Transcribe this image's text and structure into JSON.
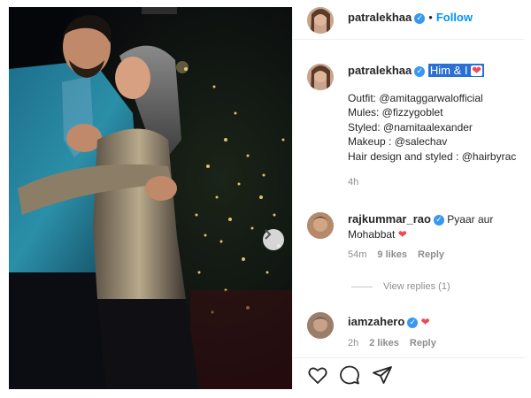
{
  "post": {
    "author": "patralekhaa",
    "header_separator": "•",
    "follow_label": "Follow",
    "caption_highlight": "Him & I",
    "caption_lines": [
      "Outfit: @amitaggarwalofficial",
      "Mules: @fizzygoblet",
      "Styled: @namitaalexander",
      "Makeup : @salechav",
      "Hair design and styled : @hairbyrac"
    ],
    "caption_time": "4h"
  },
  "comments": [
    {
      "user": "rajkummar_rao",
      "text": "Pyaar aur Mohabbat",
      "time": "54m",
      "likes": "9 likes",
      "reply_label": "Reply",
      "view_replies": "View replies (1)"
    },
    {
      "user": "iamzahero",
      "text": "",
      "time": "2h",
      "likes": "2 likes",
      "reply_label": "Reply"
    }
  ],
  "icons": {
    "verified": "verified-badge-icon",
    "heart": "red-heart-emoji-icon",
    "next": "chevron-right-icon",
    "like": "heart-outline-icon",
    "comment": "speech-bubble-icon",
    "share": "paper-plane-icon"
  },
  "colors": {
    "link_blue": "#0095f6",
    "verified_blue": "#3897f0",
    "heart_red": "#ed4956",
    "highlight_blue": "#2a6fd6",
    "muted_gray": "#8e8e8e"
  }
}
